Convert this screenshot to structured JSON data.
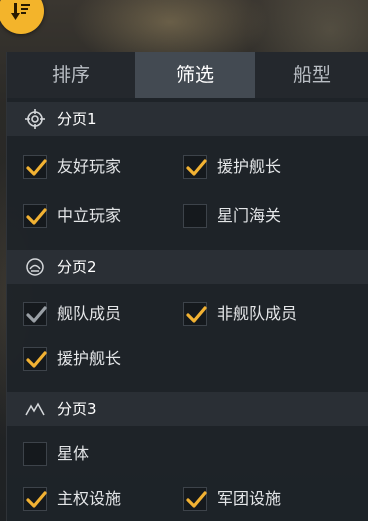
{
  "tabs": [
    {
      "label": "排序",
      "active": false
    },
    {
      "label": "筛选",
      "active": true
    },
    {
      "label": "船型",
      "active": false
    }
  ],
  "sections": [
    {
      "title": "分页1",
      "icon": "crosshair-icon",
      "options": [
        {
          "label": "友好玩家",
          "checked": true,
          "disabled": false
        },
        {
          "label": "援护舰长",
          "checked": true,
          "disabled": false
        },
        {
          "label": "中立玩家",
          "checked": true,
          "disabled": false
        },
        {
          "label": "星门海关",
          "checked": false,
          "disabled": false
        }
      ]
    },
    {
      "title": "分页2",
      "icon": "fleet-emblem-icon",
      "options": [
        {
          "label": "舰队成员",
          "checked": true,
          "disabled": true
        },
        {
          "label": "非舰队成员",
          "checked": true,
          "disabled": false
        },
        {
          "label": "援护舰长",
          "checked": true,
          "disabled": false
        }
      ]
    },
    {
      "title": "分页3",
      "icon": "mountain-icon",
      "options": [
        {
          "label": "星体",
          "checked": false,
          "disabled": false
        },
        {
          "label": "主权设施",
          "checked": true,
          "disabled": false
        },
        {
          "label": "军团设施",
          "checked": true,
          "disabled": false
        }
      ]
    }
  ],
  "colors": {
    "accent": "#f3b42b",
    "check": "#f2b233",
    "check_disabled": "#9aa0a6"
  }
}
